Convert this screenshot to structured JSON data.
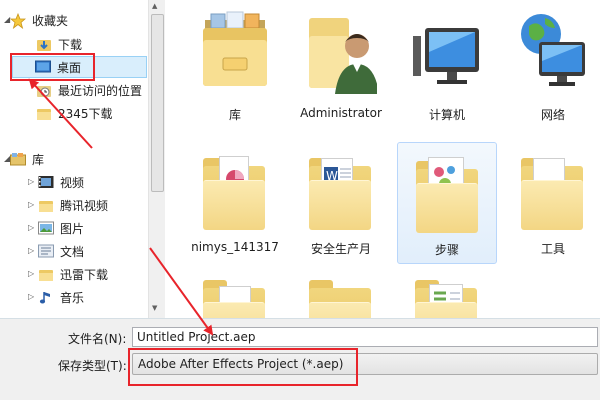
{
  "sidebar": {
    "favorites": {
      "label": "收藏夹",
      "items": [
        {
          "label": "下载",
          "icon": "download-folder-icon"
        },
        {
          "label": "桌面",
          "icon": "desktop-icon",
          "selected": true
        },
        {
          "label": "最近访问的位置",
          "icon": "recent-places-icon"
        },
        {
          "label": "2345下载",
          "icon": "folder-icon"
        }
      ]
    },
    "library": {
      "label": "库",
      "items": [
        {
          "label": "视频",
          "icon": "video-library-icon"
        },
        {
          "label": "腾讯视频",
          "icon": "folder-icon"
        },
        {
          "label": "图片",
          "icon": "picture-library-icon"
        },
        {
          "label": "文档",
          "icon": "document-library-icon"
        },
        {
          "label": "迅雷下载",
          "icon": "folder-icon"
        },
        {
          "label": "音乐",
          "icon": "music-library-icon"
        }
      ]
    }
  },
  "items": [
    {
      "label": "库",
      "icon": "library-icon"
    },
    {
      "label": "Administrator",
      "icon": "user-folder-icon"
    },
    {
      "label": "计算机",
      "icon": "computer-icon"
    },
    {
      "label": "网络",
      "icon": "network-icon"
    },
    {
      "label": "nimys_141317",
      "icon": "folder-icon"
    },
    {
      "label": "安全生产月",
      "icon": "folder-icon"
    },
    {
      "label": "步骤",
      "icon": "folder-icon"
    },
    {
      "label": "工具",
      "icon": "folder-icon"
    },
    {
      "label": "",
      "icon": "folder-icon"
    },
    {
      "label": "",
      "icon": "folder-icon"
    },
    {
      "label": "",
      "icon": "folder-icon"
    }
  ],
  "footer": {
    "filename_label": "文件名(N):",
    "filename_value": "Untitled Project.aep",
    "filetype_label": "保存类型(T):",
    "filetype_value": "Adobe After Effects Project (*.aep)"
  },
  "colors": {
    "annotation": "#e8242b",
    "selection": "#d9eefc"
  }
}
